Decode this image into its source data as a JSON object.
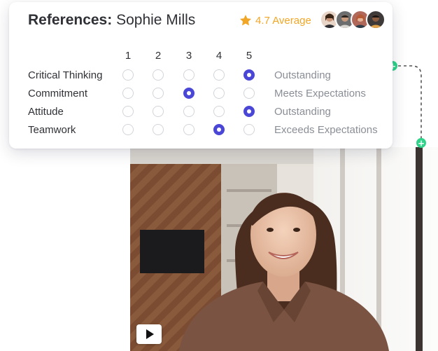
{
  "card": {
    "title_bold": "References:",
    "title_name": "Sophie Mills",
    "rating_text": "4.7 Average",
    "accent_color": "#4a46d6",
    "star_color": "#f2a626",
    "avatars": [
      "reviewer-avatar-1",
      "reviewer-avatar-2",
      "reviewer-avatar-3",
      "reviewer-avatar-4"
    ]
  },
  "scale": [
    "1",
    "2",
    "3",
    "4",
    "5"
  ],
  "rows": [
    {
      "label": "Critical Thinking",
      "selected": 5,
      "result": "Outstanding"
    },
    {
      "label": "Commitment",
      "selected": 3,
      "result": "Meets Expectations"
    },
    {
      "label": "Attitude",
      "selected": 5,
      "result": "Outstanding"
    },
    {
      "label": "Teamwork",
      "selected": 4,
      "result": "Exceeds Expectations"
    }
  ],
  "connector_color": "#2fd38a",
  "video": {
    "play_icon": "play-icon"
  }
}
